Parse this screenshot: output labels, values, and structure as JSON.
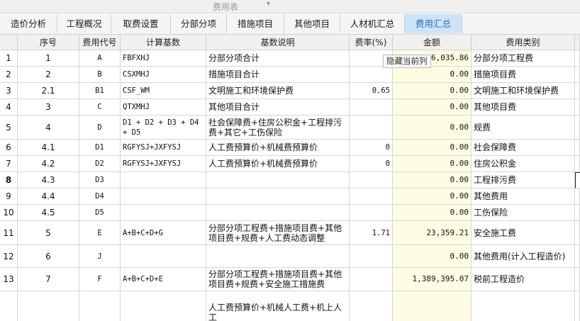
{
  "window": {
    "title": "费用表"
  },
  "tabs": [
    {
      "label": "造价分析",
      "active": false
    },
    {
      "label": "工程概况",
      "active": false
    },
    {
      "label": "取费设置",
      "active": false
    },
    {
      "label": "分部分项",
      "active": false
    },
    {
      "label": "措施项目",
      "active": false
    },
    {
      "label": "其他项目",
      "active": false
    },
    {
      "label": "人材机汇总",
      "active": false
    },
    {
      "label": "费用汇总",
      "active": true
    }
  ],
  "columns": [
    "序号",
    "费用代号",
    "计算基数",
    "基数说明",
    "费率(%)",
    "金额",
    "费用类别"
  ],
  "tooltip": "隐藏当前列",
  "rows": [
    {
      "n": "1",
      "seq": "1",
      "code": "A",
      "base": "FBFXHJ",
      "desc": "分部分项合计",
      "rate": "",
      "amount": "6,035.86",
      "category": "分部分项工程费"
    },
    {
      "n": "2",
      "seq": "2",
      "code": "B",
      "base": "CSXMHJ",
      "desc": "措施项目合计",
      "rate": "",
      "amount": "0.00",
      "category": "措施项目费"
    },
    {
      "n": "3",
      "seq": "2.1",
      "code": "B1",
      "base": "CSF_WM",
      "desc": "文明施工和环境保护费",
      "rate": "0.65",
      "amount": "0.00",
      "category": "文明施工和环境保护费"
    },
    {
      "n": "4",
      "seq": "3",
      "code": "C",
      "base": "QTXMHJ",
      "desc": "其他项目合计",
      "rate": "",
      "amount": "0.00",
      "category": "其他项目费"
    },
    {
      "n": "5",
      "seq": "4",
      "code": "D",
      "base": "D1 + D2 + D3 + D4 + D5",
      "desc": "社会保障费+住房公积金+工程排污费+其它+工伤保险",
      "rate": "",
      "amount": "0.00",
      "category": "规费"
    },
    {
      "n": "6",
      "seq": "4.1",
      "code": "D1",
      "base": "RGFYSJ+JXFYSJ",
      "desc": "人工费预算价+机械费预算价",
      "rate": "0",
      "amount": "0.00",
      "category": "社会保障费"
    },
    {
      "n": "7",
      "seq": "4.2",
      "code": "D2",
      "base": "RGFYSJ+JXFYSJ",
      "desc": "人工费预算价+机械费预算价",
      "rate": "0",
      "amount": "0.00",
      "category": "住房公积金"
    },
    {
      "n": "8",
      "seq": "4.3",
      "code": "D3",
      "base": "",
      "desc": "",
      "rate": "",
      "amount": "0.00",
      "category": "工程排污费"
    },
    {
      "n": "9",
      "seq": "4.4",
      "code": "D4",
      "base": "",
      "desc": "",
      "rate": "",
      "amount": "0.00",
      "category": "其他费用"
    },
    {
      "n": "10",
      "seq": "4.5",
      "code": "D5",
      "base": "",
      "desc": "",
      "rate": "",
      "amount": "0.00",
      "category": "工伤保险"
    },
    {
      "n": "11",
      "seq": "5",
      "code": "E",
      "base": "A+B+C+D+G",
      "desc": "分部分项工程费+措施项目费+其他项目费+规费+人工费动态调整",
      "rate": "1.71",
      "amount": "23,359.21",
      "category": "安全施工费"
    },
    {
      "n": "12",
      "seq": "6",
      "code": "J",
      "base": "",
      "desc": "",
      "rate": "",
      "amount": "0.00",
      "category": "其他费用(计入工程造价)"
    },
    {
      "n": "13",
      "seq": "7",
      "code": "F",
      "base": "A+B+C+D+E",
      "desc": "分部分项工程费+措施项目费+其他项目费+规费+安全施工措施费",
      "rate": "",
      "amount": "1,389,395.07",
      "category": "税前工程造价"
    },
    {
      "n": "",
      "seq": "",
      "code": "",
      "base": "",
      "desc": "人工费预算价+机械人工费+机上人工",
      "rate": "",
      "amount": "",
      "category": ""
    }
  ]
}
